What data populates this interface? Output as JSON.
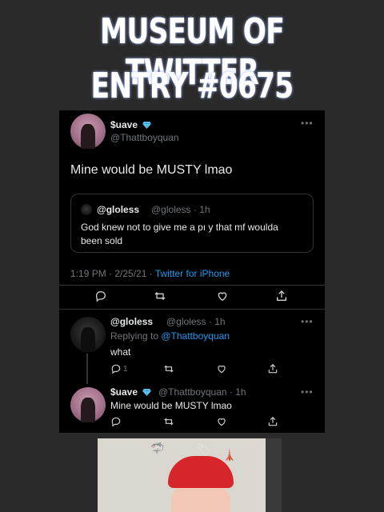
{
  "headline": {
    "line1": "MUSEUM OF TWITTER",
    "line2": "ENTRY #0675"
  },
  "main_tweet": {
    "display_name": "$uave",
    "handle": "@Thattboyquan",
    "text": "Mine would be MUSTY lmao",
    "more_label": "•••",
    "quoted": {
      "display_name": "@gloless",
      "meta": "@gloless · 1h",
      "text_line1": "God knew not to give me a pı     y that mf woulda",
      "text_line2": "been sold"
    },
    "timestamp": "1:19 PM · 2/25/21 · ",
    "source": "Twitter for iPhone"
  },
  "reply_1": {
    "display_name": "@gloless",
    "meta": "@gloless · 1h",
    "replying_prefix": "Replying to ",
    "replying_to": "@Thattboyquan",
    "text": "what",
    "reply_count": "1",
    "more_label": "•••"
  },
  "reply_2": {
    "display_name": "$uave",
    "meta": "@Thattboyquan · 1h",
    "text": "Mine would be MUSTY lmao",
    "more_label": "•••"
  },
  "colors": {
    "background": "#2a2a2a",
    "card": "#000000",
    "link_blue": "#1d9bf0",
    "muted": "#71767b",
    "verified_diamond": "#5ec8f2"
  },
  "icons": [
    "reply-icon",
    "retweet-icon",
    "like-icon",
    "share-icon",
    "diamond-icon"
  ]
}
